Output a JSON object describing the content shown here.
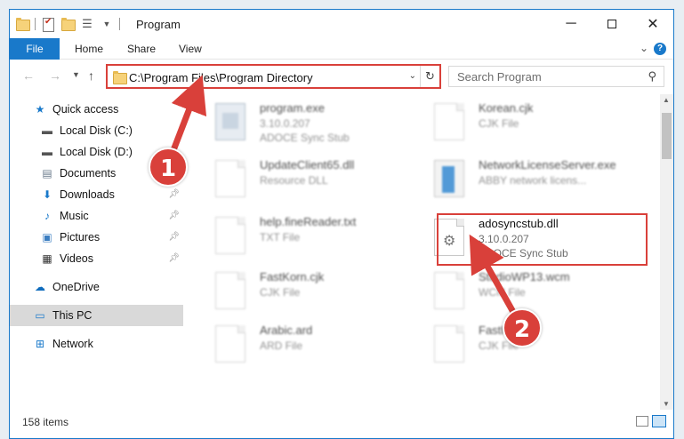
{
  "window": {
    "title": "Program"
  },
  "ribbon": {
    "tabs": [
      "File",
      "Home",
      "Share",
      "View"
    ]
  },
  "navbar": {
    "address": "C:\\Program Files\\Program Directory",
    "search_placeholder": "Search Program"
  },
  "sidebar": {
    "items": [
      {
        "label": "Quick access",
        "icon": "star-icon"
      },
      {
        "label": "Local Disk (C:)",
        "icon": "disk-icon"
      },
      {
        "label": "Local Disk (D:)",
        "icon": "disk-icon"
      },
      {
        "label": "Documents",
        "icon": "documents-icon"
      },
      {
        "label": "Downloads",
        "icon": "downloads-icon"
      },
      {
        "label": "Music",
        "icon": "music-icon"
      },
      {
        "label": "Pictures",
        "icon": "pictures-icon"
      },
      {
        "label": "Videos",
        "icon": "videos-icon"
      },
      {
        "label": "OneDrive",
        "icon": "cloud-icon"
      },
      {
        "label": "This PC",
        "icon": "computer-icon"
      },
      {
        "label": "Network",
        "icon": "network-icon"
      }
    ]
  },
  "files": [
    {
      "name": "program.exe",
      "line2": "3.10.0.207",
      "line3": "ADOCE Sync Stub",
      "icon": "exe-icon"
    },
    {
      "name": "Korean.cjk",
      "line2": "CJK File",
      "line3": "",
      "icon": "document-icon"
    },
    {
      "name": "UpdateClient65.dll",
      "line2": "Resource DLL",
      "line3": "",
      "icon": "document-icon"
    },
    {
      "name": "NetworkLicenseServer.exe",
      "line2": "ABBY network licens...",
      "line3": "",
      "icon": "app-icon"
    },
    {
      "name": "help.fineReader.txt",
      "line2": "TXT File",
      "line3": "",
      "icon": "document-icon"
    },
    {
      "name": "adosyncstub.dll",
      "line2": "3.10.0.207",
      "line3": "ADOCE Sync Stub",
      "icon": "dll-icon"
    },
    {
      "name": "FastKorn.cjk",
      "line2": "CJK File",
      "line3": "",
      "icon": "document-icon"
    },
    {
      "name": "StudioWP13.wcm",
      "line2": "WCM File",
      "line3": "",
      "icon": "document-icon"
    },
    {
      "name": "Arabic.ard",
      "line2": "ARD File",
      "line3": "",
      "icon": "document-icon"
    },
    {
      "name": "FastKor...",
      "line2": "CJK File",
      "line3": "",
      "icon": "document-icon"
    }
  ],
  "annotations": {
    "step1": "1",
    "step2": "2",
    "highlight_color": "#d9403a"
  },
  "status": {
    "count": "158 items"
  },
  "colors": {
    "accent": "#1979ca",
    "annotation": "#d9403a"
  }
}
